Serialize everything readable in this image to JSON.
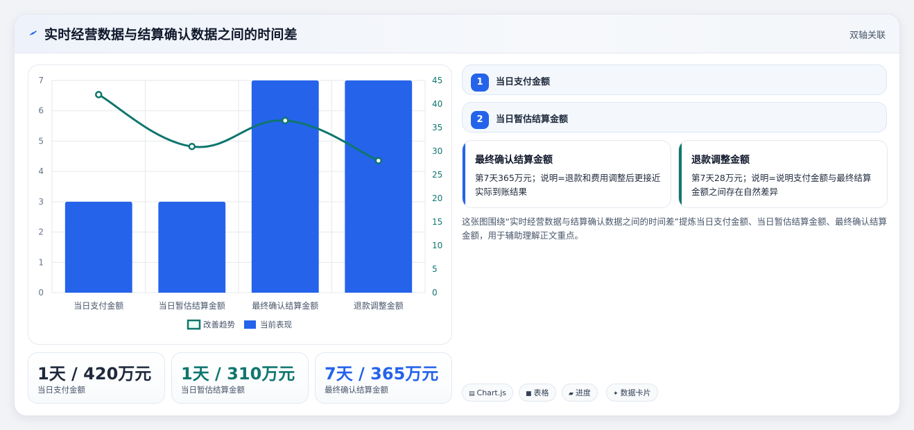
{
  "header": {
    "title": "实时经营数据与结算确认数据之间的时间差",
    "tag": "双轴关联",
    "icon": "lightning-icon"
  },
  "chart_data": {
    "type": "bar",
    "categories": [
      "当日支付金额",
      "当日暂估结算金额",
      "最终确认结算金额",
      "退款调整金额"
    ],
    "series": [
      {
        "name": "当前表现",
        "type": "bar",
        "axis": "left",
        "color": "#2563eb",
        "values": [
          3,
          3,
          7,
          7
        ]
      },
      {
        "name": "改善趋势",
        "type": "line",
        "axis": "right",
        "color": "#0f766e",
        "values": [
          42,
          31,
          36.5,
          28
        ]
      }
    ],
    "y_left": {
      "min": 0,
      "max": 7,
      "ticks": [
        "0",
        "1",
        "2",
        "3",
        "4",
        "5",
        "6",
        "7"
      ]
    },
    "y_right": {
      "min": 0,
      "max": 45,
      "ticks": [
        "0",
        "5",
        "10",
        "15",
        "20",
        "25",
        "30",
        "35",
        "40",
        "45"
      ]
    },
    "grid": true,
    "legend_position": "bottom"
  },
  "stats": [
    {
      "value": "1天 / 420万元",
      "label": "当日支付金额",
      "color": "#1e293b"
    },
    {
      "value": "1天 / 310万元",
      "label": "当日暂估结算金额",
      "color": "#0f766e"
    },
    {
      "value": "7天 / 365万元",
      "label": "最终确认结算金额",
      "color": "#2563eb"
    }
  ],
  "steps": [
    {
      "num": "1",
      "label": "当日支付金额"
    },
    {
      "num": "2",
      "label": "当日暂估结算金额"
    }
  ],
  "cards": [
    {
      "title": "最终确认结算金额",
      "desc": "第7天365万元；说明=退款和费用调整后更接近实际到账结果",
      "accent": "#2563eb"
    },
    {
      "title": "退款调整金额",
      "desc": "第7天28万元；说明=说明支付金额与最终结算金额之间存在自然差异",
      "accent": "#0f766e"
    }
  ],
  "description": "这张图围绕“实时经营数据与结算确认数据之间的时间差”提炼当日支付金额、当日暂估结算金额、最终确认结算金额，用于辅助理解正文重点。",
  "chips": [
    {
      "icon": "▤",
      "icon_name": "chart-icon",
      "label": "Chart.js"
    },
    {
      "icon": "■",
      "icon_name": "table-icon",
      "label": "表格"
    },
    {
      "icon": "▰",
      "icon_name": "progress-icon",
      "label": "进度"
    },
    {
      "icon": "✦",
      "icon_name": "sparkle-icon",
      "label": "数据卡片"
    }
  ]
}
